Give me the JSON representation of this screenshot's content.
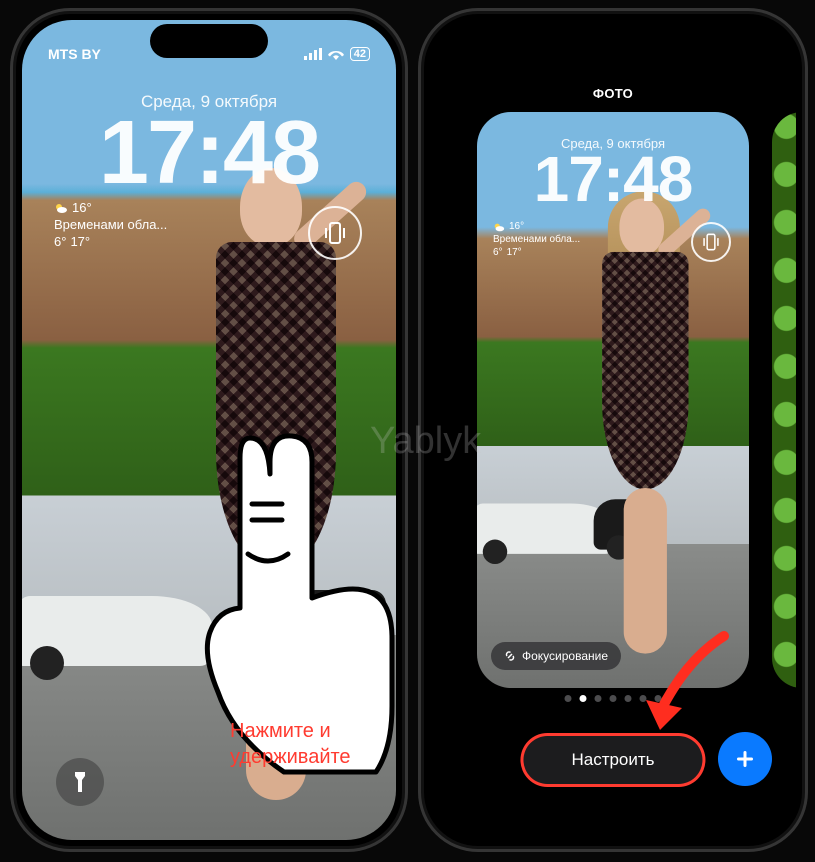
{
  "watermark": "Yablyk",
  "left_phone": {
    "carrier": "MTS BY",
    "battery": "42",
    "date": "Среда, 9 октября",
    "time": "17:48",
    "weather": {
      "temp_now": "16°",
      "condition": "Временами обла...",
      "high": "6°",
      "low": "17°"
    },
    "press_hint_l1": "Нажмите и",
    "press_hint_l2": "удерживайте"
  },
  "right_phone": {
    "section_label": "ФОТО",
    "card": {
      "date": "Среда, 9 октября",
      "time": "17:48",
      "weather": {
        "temp_now": "16°",
        "condition": "Временами обла...",
        "high": "6°",
        "low": "17°"
      }
    },
    "focus_pill": "Фокусирование",
    "page_dots": {
      "total": 7,
      "active": 1
    },
    "customize_button": "Настроить"
  }
}
